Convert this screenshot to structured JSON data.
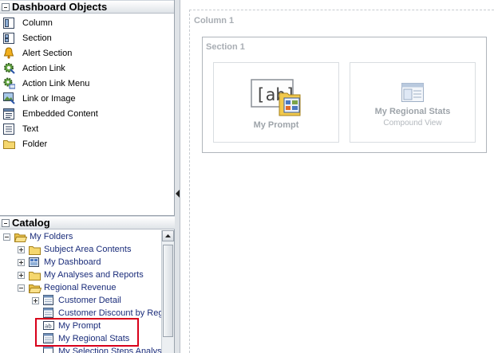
{
  "dashboard_objects": {
    "title": "Dashboard Objects",
    "items": [
      {
        "label": "Column",
        "icon": "column-icon"
      },
      {
        "label": "Section",
        "icon": "section-icon"
      },
      {
        "label": "Alert Section",
        "icon": "bell-icon"
      },
      {
        "label": "Action Link",
        "icon": "gear-link-icon"
      },
      {
        "label": "Action Link Menu",
        "icon": "gear-menu-icon"
      },
      {
        "label": "Link or Image",
        "icon": "link-image-icon"
      },
      {
        "label": "Embedded Content",
        "icon": "embedded-content-icon"
      },
      {
        "label": "Text",
        "icon": "text-icon"
      },
      {
        "label": "Folder",
        "icon": "folder-icon"
      }
    ]
  },
  "catalog": {
    "title": "Catalog",
    "tree": [
      {
        "label": "My Folders",
        "level": 0,
        "expander": "minus",
        "icon": "folder-open-icon"
      },
      {
        "label": "Subject Area Contents",
        "level": 1,
        "expander": "plus",
        "icon": "folder-icon"
      },
      {
        "label": "My Dashboard",
        "level": 1,
        "expander": "plus",
        "icon": "dashboard-icon"
      },
      {
        "label": "My Analyses and Reports",
        "level": 1,
        "expander": "plus",
        "icon": "folder-icon"
      },
      {
        "label": "Regional Revenue",
        "level": 1,
        "expander": "minus",
        "icon": "folder-open-icon"
      },
      {
        "label": "Customer Detail",
        "level": 2,
        "expander": "plus",
        "icon": "analysis-icon"
      },
      {
        "label": "Customer Discount by Regi",
        "level": 2,
        "expander": "none",
        "icon": "analysis-icon"
      },
      {
        "label": "My Prompt",
        "level": 2,
        "expander": "none",
        "icon": "prompt-icon"
      },
      {
        "label": "My Regional Stats",
        "level": 2,
        "expander": "none",
        "icon": "analysis-icon"
      },
      {
        "label": "My Selection Steps Analysi",
        "level": 2,
        "expander": "none",
        "icon": "analysis-icon"
      }
    ]
  },
  "canvas": {
    "column_title": "Column 1",
    "section_title": "Section 1",
    "tiles": [
      {
        "name": "My Prompt",
        "sub": ""
      },
      {
        "name": "My Regional Stats",
        "sub": "Compound View"
      }
    ]
  },
  "colors": {
    "highlight": "#d8001a",
    "tree_text": "#1a2c7a",
    "placeholder_text": "#a9aeb4"
  }
}
